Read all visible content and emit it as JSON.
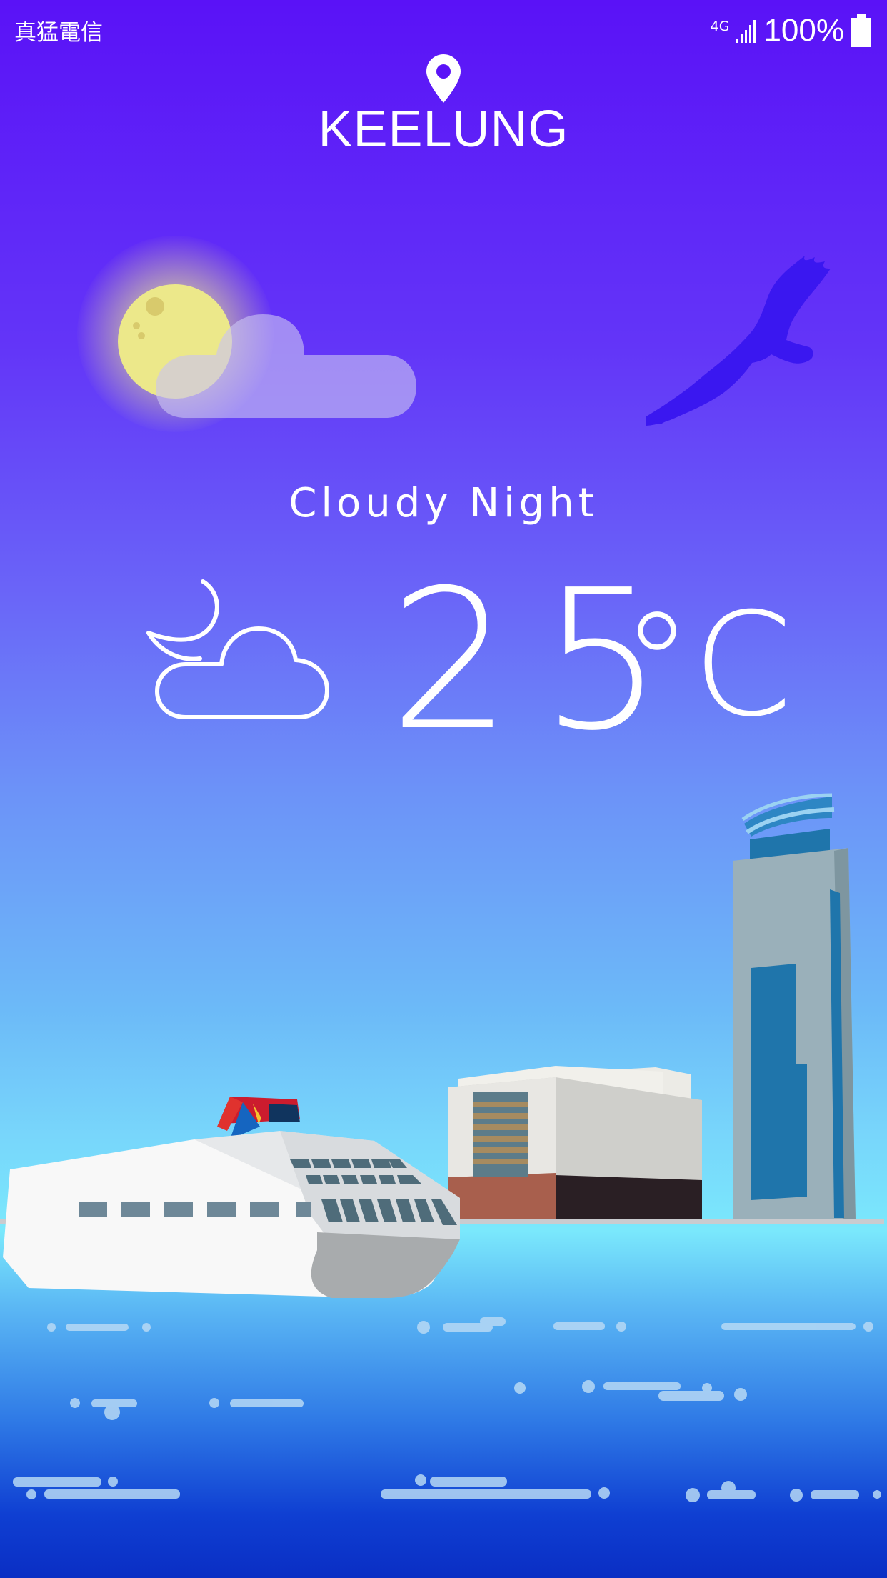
{
  "status_bar": {
    "carrier": "真猛電信",
    "network": "4G",
    "battery_percent": "100%"
  },
  "location": {
    "icon": "location-pin-icon",
    "city": "KEELUNG"
  },
  "weather": {
    "condition": "Cloudy Night",
    "condition_icon": "cloudy-night-icon",
    "temperature": "25",
    "unit": "°C"
  },
  "colors": {
    "sky_top": "#5a12f7",
    "sky_horizon": "#7ae8fc",
    "sea_deep": "#0a2ec4",
    "moon": "#ece88a",
    "eagle": "#3a17f0",
    "tower_blue": "#1f75ab"
  }
}
